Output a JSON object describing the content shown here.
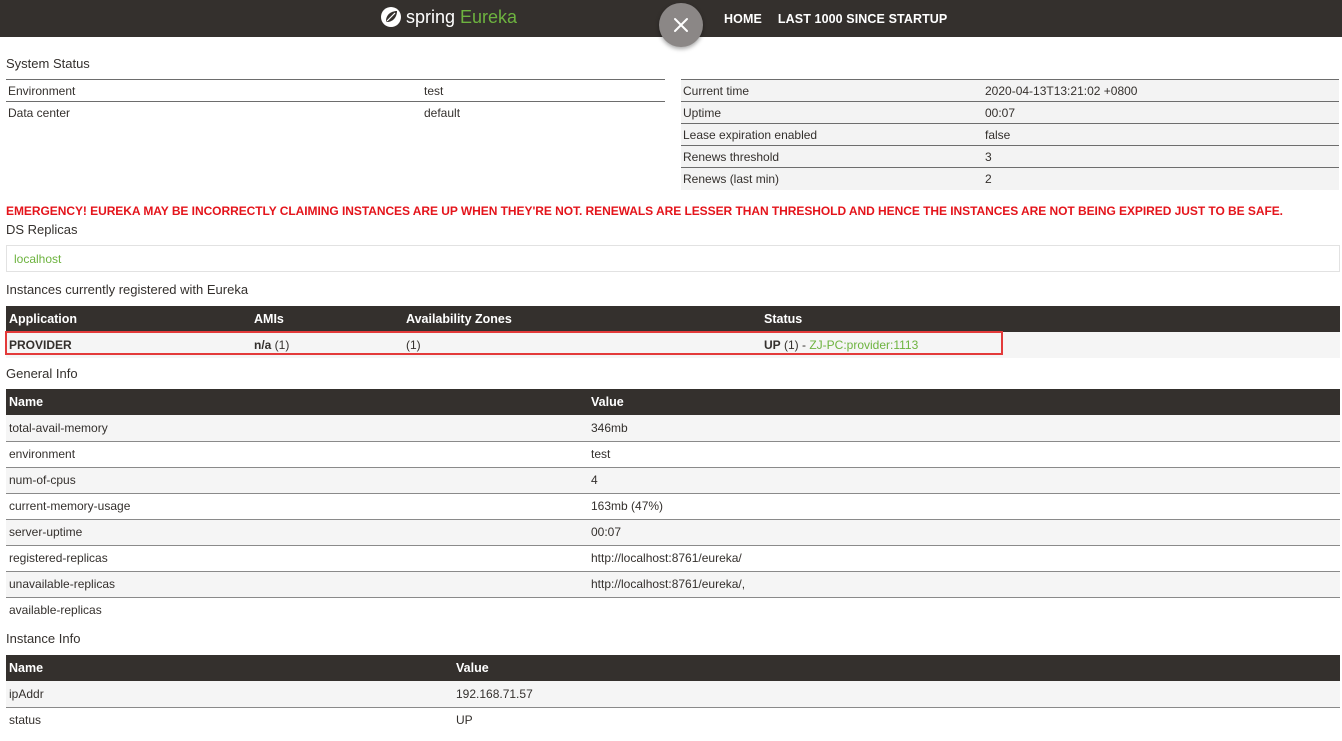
{
  "nav": {
    "brand_spring": "spring",
    "brand_eureka": "Eureka",
    "links": [
      "HOME",
      "LAST 1000 SINCE STARTUP"
    ],
    "close_icon": "×"
  },
  "system_status": {
    "title": "System Status",
    "left": [
      {
        "k": "Environment",
        "v": "test"
      },
      {
        "k": "Data center",
        "v": "default"
      }
    ],
    "right": [
      {
        "k": "Current time",
        "v": "2020-04-13T13:21:02 +0800"
      },
      {
        "k": "Uptime",
        "v": "00:07"
      },
      {
        "k": "Lease expiration enabled",
        "v": "false"
      },
      {
        "k": "Renews threshold",
        "v": "3"
      },
      {
        "k": "Renews (last min)",
        "v": "2"
      }
    ]
  },
  "emergency": "EMERGENCY! EUREKA MAY BE INCORRECTLY CLAIMING INSTANCES ARE UP WHEN THEY'RE NOT. RENEWALS ARE LESSER THAN THRESHOLD AND HENCE THE INSTANCES ARE NOT BEING EXPIRED JUST TO BE SAFE.",
  "ds_replicas": {
    "title": "DS Replicas",
    "items": [
      "localhost"
    ]
  },
  "instances": {
    "title": "Instances currently registered with Eureka",
    "headers": [
      "Application",
      "AMIs",
      "Availability Zones",
      "Status"
    ],
    "row": {
      "application": "PROVIDER",
      "amis_bold": "n/a",
      "amis_count": " (1)",
      "zones": "(1)",
      "status_bold": "UP",
      "status_count": " (1) - ",
      "status_link": "ZJ-PC:provider:1113"
    }
  },
  "general_info": {
    "title": "General Info",
    "headers": [
      "Name",
      "Value"
    ],
    "rows": [
      [
        "total-avail-memory",
        "346mb"
      ],
      [
        "environment",
        "test"
      ],
      [
        "num-of-cpus",
        "4"
      ],
      [
        "current-memory-usage",
        "163mb (47%)"
      ],
      [
        "server-uptime",
        "00:07"
      ],
      [
        "registered-replicas",
        "http://localhost:8761/eureka/"
      ],
      [
        "unavailable-replicas",
        "http://localhost:8761/eureka/,"
      ],
      [
        "available-replicas",
        ""
      ]
    ]
  },
  "instance_info": {
    "title": "Instance Info",
    "headers": [
      "Name",
      "Value"
    ],
    "rows": [
      [
        "ipAddr",
        "192.168.71.57"
      ],
      [
        "status",
        "UP"
      ]
    ]
  },
  "colors": {
    "nav_bg": "#34302d",
    "accent_green": "#6db33f",
    "emergency_red": "#e4141b",
    "highlight_red": "#e33a3a"
  }
}
